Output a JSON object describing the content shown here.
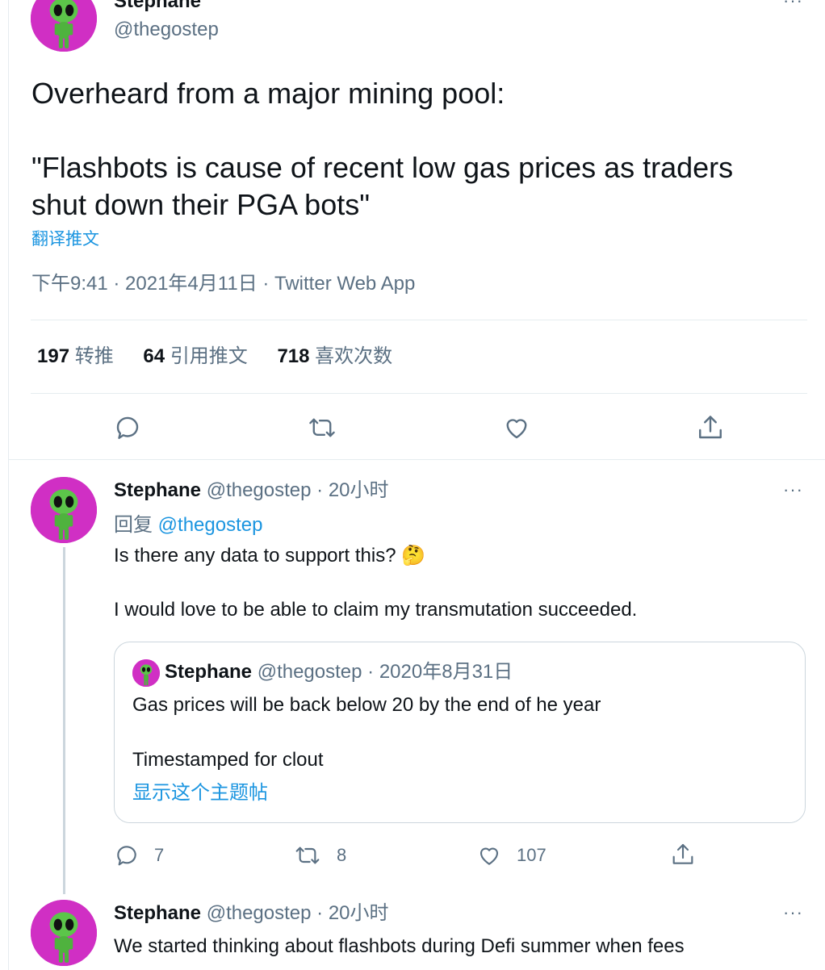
{
  "main_tweet": {
    "author_name": "Stephane",
    "handle": "@thegostep",
    "text_line1": "Overheard from a major mining pool:",
    "text_line2": "\"Flashbots is cause of recent low gas prices as traders",
    "text_line3": "shut down their PGA bots\"",
    "translate_label": "翻译推文",
    "timestamp": "下午9:41 · 2021年4月11日 · Twitter Web App",
    "stats": {
      "retweets_count": "197",
      "retweets_label": "转推",
      "quotes_count": "64",
      "quotes_label": "引用推文",
      "likes_count": "718",
      "likes_label": "喜欢次数"
    }
  },
  "reply1": {
    "author_name": "Stephane",
    "handle": "@thegostep",
    "time": "· 20小时",
    "reply_to_prefix": "回复",
    "reply_to_handle": "@thegostep",
    "text_line1": "Is there any data to support this? 🤔",
    "text_line2": "I would love to be able to claim my transmutation succeeded.",
    "quote": {
      "author_name": "Stephane",
      "handle": "@thegostep",
      "time": "· 2020年8月31日",
      "text_line1": "Gas prices will be back below 20 by the end of he year",
      "text_line2": "Timestamped for clout",
      "show_thread": "显示这个主题帖"
    },
    "actions": {
      "reply_count": "7",
      "retweet_count": "8",
      "like_count": "107"
    }
  },
  "reply2": {
    "author_name": "Stephane",
    "handle": "@thegostep",
    "time": "· 20小时",
    "text_line1": "We started thinking about flashbots during Defi summer when fees"
  },
  "more_symbol": "···",
  "colors": {
    "accent": "#1b95e0",
    "muted": "#5b7083",
    "avatar_bg": "#d02fc4",
    "border": "#e6ecf0"
  }
}
